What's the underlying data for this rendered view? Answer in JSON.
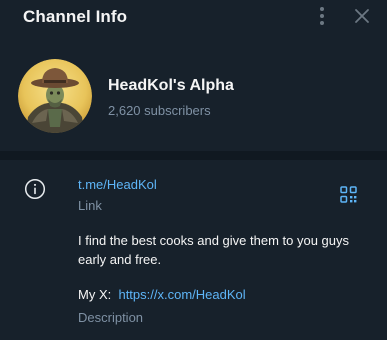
{
  "header": {
    "title": "Channel Info",
    "menu_icon": "more-vertical-icon",
    "close_icon": "close-icon"
  },
  "channel": {
    "name": "HeadKol's Alpha",
    "subscribers": "2,620 subscribers",
    "avatar_icon": "channel-avatar"
  },
  "info": {
    "icon": "info-icon",
    "link": "t.me/HeadKol",
    "link_caption": "Link",
    "qr_icon": "qr-code-icon",
    "description_line1": "I find the best cooks and give them to you guys early and free.",
    "description_prefix": "My X:",
    "description_link": "https://x.com/HeadKol",
    "description_caption": "Description"
  },
  "colors": {
    "background": "#17212b",
    "divider": "#101921",
    "text_primary": "#f5f5f5",
    "text_secondary": "#7f91a4",
    "link": "#5eb5f7"
  }
}
